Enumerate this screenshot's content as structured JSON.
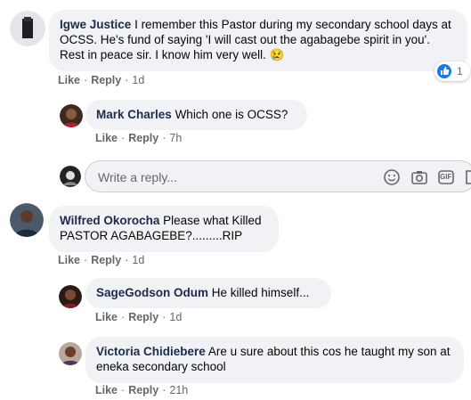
{
  "colors": {
    "bubble_bg": "#f0f2f5",
    "author": "#1c2b4a",
    "meta": "#65676b",
    "like_blue": "#1877f2"
  },
  "comments": [
    {
      "author": "Igwe Justice",
      "text": "I remember this Pastor during my secondary school days at OCSS. He's fund of saying 'I will cast out the agabagebe spirit in you'. Rest in peace sir. I know him very well. ",
      "emoji": "😢",
      "like_label": "Like",
      "reply_label": "Reply",
      "time": "1d",
      "reaction_icon": "thumbs-up-icon",
      "reaction_count": "1"
    },
    {
      "author": "Mark Charles",
      "text": "Which one is OCSS?",
      "like_label": "Like",
      "reply_label": "Reply",
      "time": "7h"
    },
    {
      "author": "Wilfred Okorocha",
      "text": "Please what Killed PASTOR AGABAGEBE?.........RIP",
      "like_label": "Like",
      "reply_label": "Reply",
      "time": "1d"
    },
    {
      "author": "SageGodson Odum",
      "text": "He killed himself...",
      "like_label": "Like",
      "reply_label": "Reply",
      "time": "1d"
    },
    {
      "author": "Victoria Chidiebere",
      "text": "Are u sure about this cos he taught my son at eneka secondary school",
      "like_label": "Like",
      "reply_label": "Reply",
      "time": "21h"
    }
  ],
  "reply_box": {
    "placeholder": "Write a reply...",
    "icons": [
      "emoji-icon",
      "camera-icon",
      "gif-icon",
      "sticker-icon"
    ],
    "gif_label": "GIF"
  }
}
